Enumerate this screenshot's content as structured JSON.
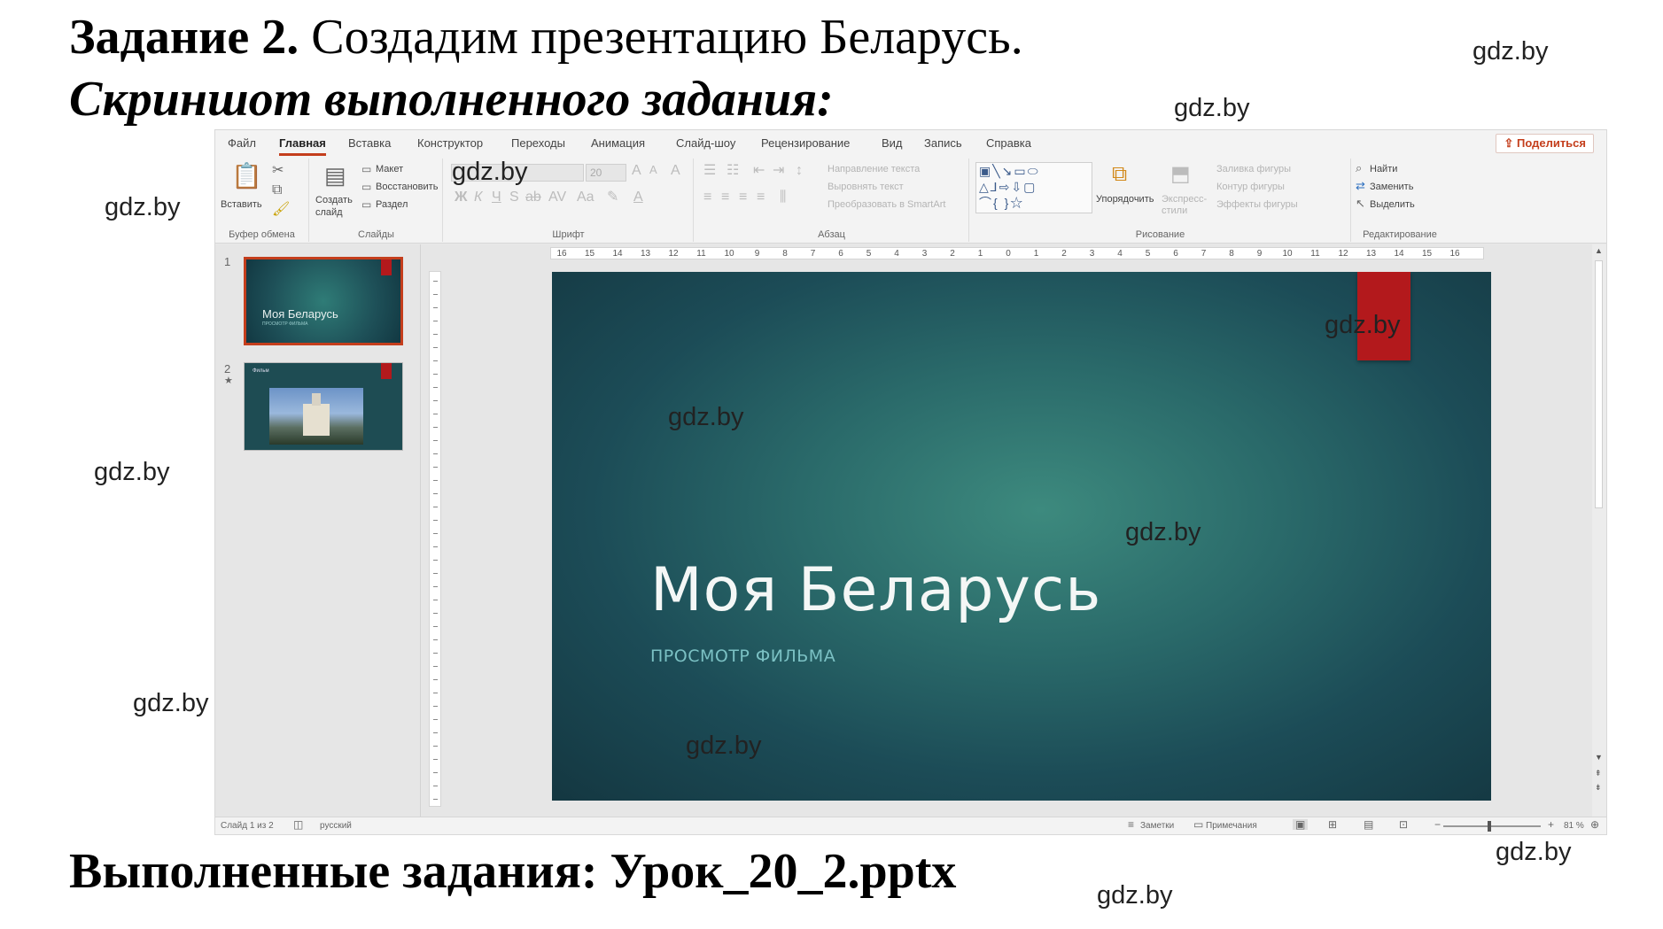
{
  "document": {
    "task_label": "Задание 2.",
    "task_text": "Создадим презентацию Беларусь.",
    "screenshot_caption": "Скриншот выполненного задания:",
    "result_line": "Выполненные задания: Урок_20_2.pptx"
  },
  "watermark": "gdz.by",
  "menu": {
    "tabs": [
      "Файл",
      "Главная",
      "Вставка",
      "Конструктор",
      "Переходы",
      "Анимация",
      "Слайд-шоу",
      "Рецензирование",
      "Вид",
      "Запись",
      "Справка"
    ],
    "share_label": "Поделиться"
  },
  "ribbon": {
    "clipboard": {
      "paste_label": "Вставить",
      "group_label": "Буфер обмена"
    },
    "slides": {
      "new_slide_label": "Создать слайд",
      "layout_label": "Макет",
      "reset_label": "Восстановить",
      "section_label": "Раздел",
      "group_label": "Слайды"
    },
    "font": {
      "font_size": "20",
      "group_label": "Шрифт"
    },
    "paragraph": {
      "text_direction_label": "Направление текста",
      "align_text_label": "Выровнять текст",
      "smartart_label": "Преобразовать в SmartArt",
      "group_label": "Абзац"
    },
    "drawing": {
      "arrange_label": "Упорядочить",
      "quick_styles_label": "Экспресс-стили",
      "fill_label": "Заливка фигуры",
      "outline_label": "Контур фигуры",
      "effects_label": "Эффекты фигуры",
      "group_label": "Рисование"
    },
    "editing": {
      "find_label": "Найти",
      "replace_label": "Заменить",
      "select_label": "Выделить",
      "group_label": "Редактирование"
    }
  },
  "thumbnails": [
    {
      "number": "1",
      "title": "Моя Беларусь",
      "subtitle": "ПРОСМОТР ФИЛЬМА",
      "selected": true
    },
    {
      "number": "2",
      "title": "Фильм",
      "selected": false
    }
  ],
  "slide": {
    "title": "Моя Беларусь",
    "subtitle": "ПРОСМОТР ФИЛЬМА",
    "background": "#2a6a6a",
    "accent_tab_color": "#b3191c"
  },
  "status": {
    "slide_counter": "Слайд 1 из 2",
    "language": "русский",
    "notes_label": "Заметки",
    "comments_label": "Примечания",
    "zoom": "81 %"
  },
  "colors": {
    "accent": "#c43e1c"
  }
}
